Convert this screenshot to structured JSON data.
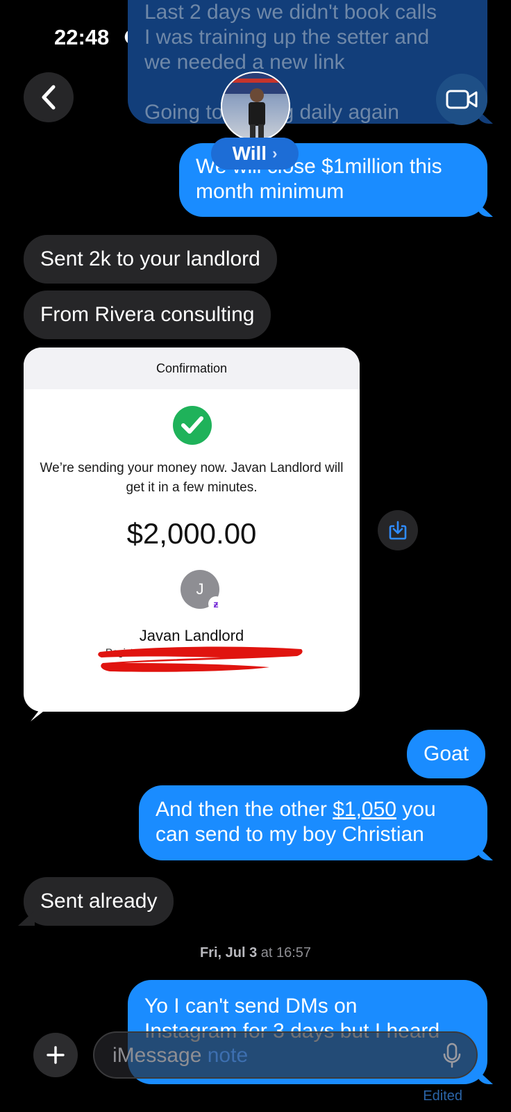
{
  "status_bar": {
    "time": "22:48"
  },
  "header": {
    "contact_name": "Will",
    "chevron": "›"
  },
  "messages": {
    "prev_out": {
      "line1": "Last 2 days we didn't book calls",
      "line2": "I was training up the setter and",
      "line3": "we needed a new link",
      "line4": "Going to closing daily again"
    },
    "close_million": {
      "line1": "We will close $1million this",
      "line2": "month minimum"
    },
    "sent_landlord": "Sent 2k to your landlord",
    "from_rivera": "From Rivera consulting",
    "goat": "Goat",
    "other_1050": {
      "prefix": "And then the other ",
      "link": "$1,050",
      "suffix": " you",
      "line2": "can send to my boy Christian"
    },
    "sent_already": "Sent already",
    "timestamp": {
      "day": "Fri, Jul 3",
      "at": " at 16:57"
    },
    "last_out": {
      "line1": "Yo I can't send DMs on",
      "line2": "Instagram for 3 days but I heard"
    },
    "edited": "Edited"
  },
  "confirmation_card": {
    "header": "Confirmation",
    "message": "We’re sending your money now. Javan Landlord will get it in a few minutes.",
    "amount": "$2,000.00",
    "recipient_initial": "J",
    "recipient_name": "Javan Landlord",
    "registered_as": "Registered as",
    "badge_symbol": "ƶ",
    "check_color": "#1fb25a",
    "redaction_color": "#e0140f"
  },
  "composer": {
    "placeholder": "iMessage",
    "overlay_text": "note"
  },
  "colors": {
    "outgoing": "#1a8cff",
    "incoming": "#262628",
    "background": "#000000"
  },
  "icons": [
    "moon-icon",
    "signal-icon",
    "wifi-icon",
    "battery-icon",
    "back-chevron-icon",
    "video-camera-icon",
    "checkmark-icon",
    "save-download-icon",
    "plus-icon",
    "microphone-icon"
  ]
}
